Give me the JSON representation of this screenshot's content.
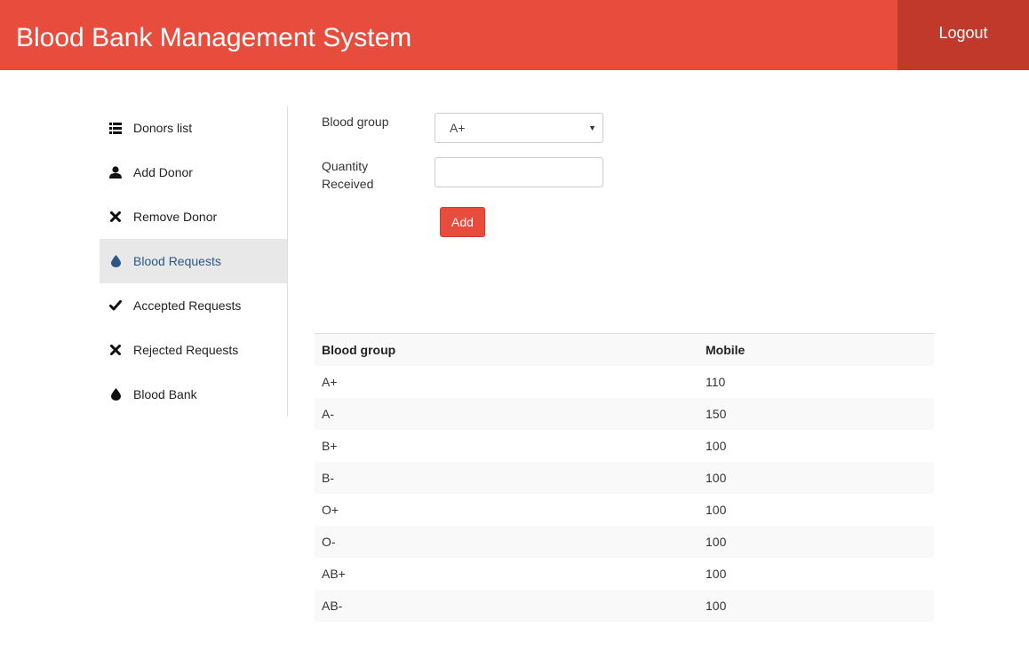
{
  "header": {
    "title": "Blood Bank Management System",
    "logout_label": "Logout"
  },
  "sidebar": {
    "items": [
      {
        "label": "Donors list",
        "icon": "list-icon",
        "active": false
      },
      {
        "label": "Add Donor",
        "icon": "user-icon",
        "active": false
      },
      {
        "label": "Remove Donor",
        "icon": "close-icon",
        "active": false
      },
      {
        "label": "Blood Requests",
        "icon": "drop-icon",
        "active": true
      },
      {
        "label": "Accepted Requests",
        "icon": "check-icon",
        "active": false
      },
      {
        "label": "Rejected Requests",
        "icon": "close-icon",
        "active": false
      },
      {
        "label": "Blood Bank",
        "icon": "drop-icon",
        "active": false
      }
    ]
  },
  "form": {
    "blood_group_label": "Blood group",
    "blood_group_value": "A+",
    "quantity_label_line1": "Quantity",
    "quantity_label_line2": "Received",
    "quantity_value": "",
    "add_label": "Add"
  },
  "table": {
    "headers": [
      "Blood group",
      "Mobile"
    ],
    "rows": [
      [
        "A+",
        "110"
      ],
      [
        "A-",
        "150"
      ],
      [
        "B+",
        "100"
      ],
      [
        "B-",
        "100"
      ],
      [
        "O+",
        "100"
      ],
      [
        "O-",
        "100"
      ],
      [
        "AB+",
        "100"
      ],
      [
        "AB-",
        "100"
      ]
    ]
  },
  "colors": {
    "brand": "#e84c3d",
    "brand_dark": "#c0392b",
    "active_text": "#2a5785"
  }
}
